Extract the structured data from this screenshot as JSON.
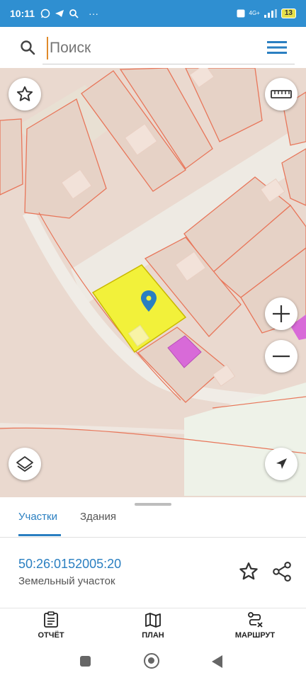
{
  "status_bar": {
    "time": "10:11",
    "app_icons": [
      "whatsapp-icon",
      "telegram-icon",
      "search-icon"
    ],
    "more": "···",
    "network": "4G+",
    "battery": "13"
  },
  "search": {
    "placeholder": "Поиск"
  },
  "sheet": {
    "tabs": [
      {
        "label": "Участки",
        "active": true
      },
      {
        "label": "Здания",
        "active": false
      }
    ],
    "cadastral_number": "50:26:0152005:20",
    "parcel_type": "Земельный участок"
  },
  "bottom_nav": {
    "items": [
      {
        "label": "ОТЧЁТ",
        "icon": "report-icon"
      },
      {
        "label": "ПЛАН",
        "icon": "map-plan-icon"
      },
      {
        "label": "МАРШРУТ",
        "icon": "route-icon"
      }
    ]
  },
  "colors": {
    "status_bar": "#2f8fd1",
    "accent": "#2a7fc1",
    "selected_parcel": "#f2f13a",
    "parcel_border": "#e8765a",
    "building": "#d86ad8",
    "map_bg": "#ead9cf"
  }
}
